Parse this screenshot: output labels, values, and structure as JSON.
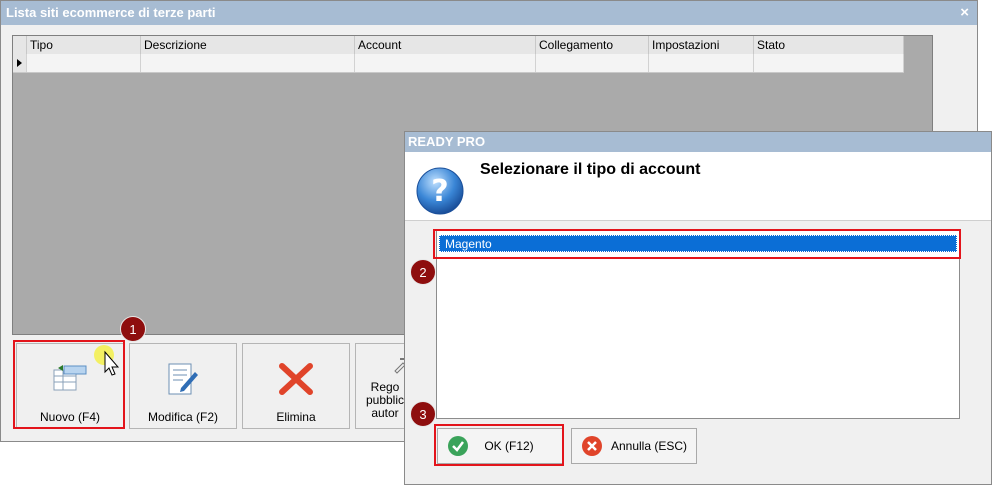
{
  "main_window": {
    "title": "Lista siti ecommerce di terze parti",
    "close_glyph": "×",
    "grid": {
      "columns": [
        "Tipo",
        "Descrizione",
        "Account",
        "Collegamento",
        "Impostazioni",
        "Stato"
      ],
      "rows": [
        [
          "",
          "",
          "",
          "",
          "",
          ""
        ]
      ]
    },
    "toolbar": {
      "new_label": "Nuovo (F4)",
      "edit_label": "Modifica (F2)",
      "delete_label": "Elimina",
      "rules_label_lines": [
        "Rego",
        "pubblic",
        "autor"
      ]
    }
  },
  "dialog": {
    "title": "READY PRO",
    "heading": "Selezionare il tipo di account",
    "icon": "question-icon",
    "account_types": [
      "Magento"
    ],
    "selected_index": 0,
    "ok_label": "OK (F12)",
    "cancel_label": "Annulla (ESC)"
  },
  "callouts": [
    "1",
    "2",
    "3"
  ],
  "colors": {
    "title_bar": "#a7bcd3",
    "grid_background": "#aaaaaa",
    "selection": "#0b6ed6",
    "callout_frame": "#e3141b",
    "callout_marker": "#8e0e0e"
  }
}
